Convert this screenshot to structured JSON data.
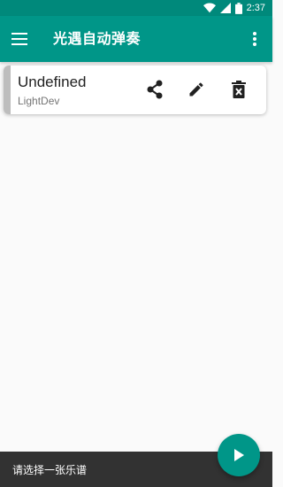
{
  "status_bar": {
    "time": "2:37",
    "icons": [
      "wifi-icon",
      "signal-icon",
      "battery-icon"
    ]
  },
  "toolbar": {
    "title": "光遇自动弹奏",
    "menu_icon": "hamburger-menu-icon",
    "overflow_icon": "more-vert-icon"
  },
  "sheets": [
    {
      "title": "Undefined",
      "author": "LightDev",
      "actions": [
        "share-icon",
        "edit-icon",
        "delete-icon"
      ]
    }
  ],
  "snackbar": {
    "message": "请选择一张乐谱"
  },
  "fab": {
    "icon": "play-icon"
  },
  "colors": {
    "primary": "#009688",
    "primary_dark": "#00897b",
    "snackbar_bg": "#323232",
    "background": "#fafafa"
  }
}
